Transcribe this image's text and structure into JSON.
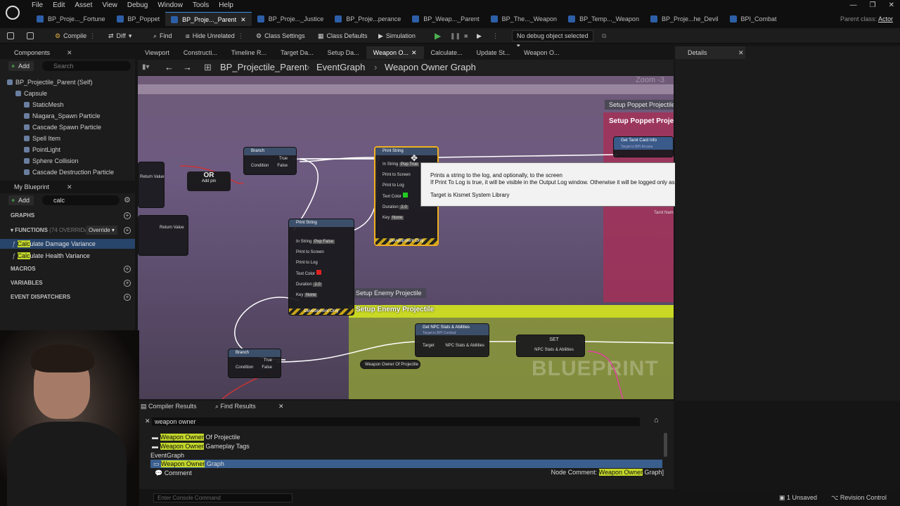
{
  "menu": [
    "File",
    "Edit",
    "Asset",
    "View",
    "Debug",
    "Window",
    "Tools",
    "Help"
  ],
  "window_controls": [
    "—",
    "❐",
    "✕"
  ],
  "tabs": [
    {
      "label": "BP_Proje..._Fortune",
      "active": false
    },
    {
      "label": "BP_Poppet",
      "active": false
    },
    {
      "label": "BP_Proje..._Parent",
      "active": true
    },
    {
      "label": "BP_Proje..._Justice",
      "active": false
    },
    {
      "label": "BP_Proje...perance",
      "active": false
    },
    {
      "label": "BP_Weap..._Parent",
      "active": false
    },
    {
      "label": "BP_The..._Weapon",
      "active": false
    },
    {
      "label": "BP_Temp..._Weapon",
      "active": false
    },
    {
      "label": "BP_Proje...he_Devil",
      "active": false
    },
    {
      "label": "BPI_Combat",
      "active": false
    }
  ],
  "parent_class": {
    "label": "Parent class:",
    "value": "Actor"
  },
  "toolbar": {
    "compile": "Compile",
    "diff": "Diff",
    "find": "Find",
    "hide_unrelated": "Hide Unrelated",
    "class_settings": "Class Settings",
    "class_defaults": "Class Defaults",
    "simulation": "Simulation",
    "debug_object": "No debug object selected"
  },
  "components": {
    "title": "Components",
    "add": "Add",
    "search_placeholder": "Search",
    "tree": [
      {
        "label": "BP_Projectile_Parent (Self)",
        "indent": 0
      },
      {
        "label": "Capsule",
        "indent": 1
      },
      {
        "label": "StaticMesh",
        "indent": 2
      },
      {
        "label": "Niagara_Spawn Particle",
        "indent": 2
      },
      {
        "label": "Cascade Spawn Particle",
        "indent": 2
      },
      {
        "label": "Spell Item",
        "indent": 2
      },
      {
        "label": "PointLight",
        "indent": 2
      },
      {
        "label": "Sphere Collision",
        "indent": 2
      },
      {
        "label": "Cascade Destruction Particle",
        "indent": 2
      }
    ]
  },
  "my_blueprint": {
    "title": "My Blueprint",
    "add": "Add",
    "search_value": "calc",
    "sections": {
      "graphs": "GRAPHS",
      "functions": "FUNCTIONS",
      "functions_count": "(74 OVERRIDABLE)",
      "override": "Override",
      "macros": "MACROS",
      "variables": "VARIABLES",
      "event_dispatchers": "EVENT DISPATCHERS"
    },
    "functions": [
      {
        "match": "Calc",
        "rest": "ulate Damage Variance",
        "selected": true
      },
      {
        "match": "Calc",
        "rest": "ulate Health Variance",
        "selected": false
      }
    ]
  },
  "graph_tabs": [
    {
      "label": "Viewport",
      "active": false
    },
    {
      "label": "Constructi...",
      "active": false
    },
    {
      "label": "Timeline R...",
      "active": false
    },
    {
      "label": "Target Da...",
      "active": false
    },
    {
      "label": "Setup Da...",
      "active": false
    },
    {
      "label": "Weapon O...",
      "active": true
    },
    {
      "label": "Calculate...",
      "active": false
    },
    {
      "label": "Update St...",
      "active": false
    },
    {
      "label": "Weapon O...",
      "active": false
    }
  ],
  "breadcrumb": [
    "BP_Projectile_Parent",
    "EventGraph",
    "Weapon Owner Graph"
  ],
  "zoom": "Zoom -3",
  "graph": {
    "comment_setup_poppet_small": "Setup Poppet Projectile",
    "comment_setup_poppet": "Setup Poppet Projecti",
    "comment_setup_enemy_small": "Setup Enemy Projectile",
    "comment_setup_enemy": "Setup Enemy Projectile",
    "watermark": "BLUEPRINT",
    "or_label": "OR",
    "or_add_pin": "Add pin",
    "return_value": "Return Value",
    "branch1": {
      "title": "Branch",
      "pins": [
        "Condition",
        "True",
        "False"
      ]
    },
    "branch2": {
      "title": "Branch",
      "pins": [
        "Condition",
        "True",
        "False"
      ]
    },
    "print1": {
      "title": "Print String",
      "in_string": "In String",
      "in_value": "Pop True",
      "pins": [
        "Print to Screen",
        "Print to Log",
        "Text Color",
        "Duration",
        "Key"
      ],
      "duration": "2.0",
      "key": "None",
      "dev": "Development Only"
    },
    "print2": {
      "title": "Print String",
      "in_string": "In String",
      "in_value": "Pop False",
      "pins": [
        "Print to Screen",
        "Print to Log",
        "Text Color",
        "Duration",
        "Key"
      ],
      "duration": "2.0",
      "key": "None",
      "dev": "Development Only"
    },
    "tarot": {
      "title": "Get Tarot Card Info",
      "subtitle": "Target is BPI Arcana"
    },
    "tarot_name": "Tarot Nam",
    "npc": {
      "title": "Get NPC Stats & Abilities",
      "subtitle": "Target is BPI Combat",
      "pins": [
        "Target",
        "NPC Stats & Abilities"
      ]
    },
    "set": {
      "title": "SET",
      "pin": "NPC Stats & Abilities"
    },
    "weapon_owner_node": "Weapon Owner Of Projectile"
  },
  "tooltip": {
    "line1": "Prints a string to the log, and optionally, to the screen",
    "line2": "If Print To Log is true, it will be visible in the Output Log window.  Otherwise it will be logged only as 'Verbose', so it generally won't show up.",
    "line3": "Target is Kismet System Library"
  },
  "details": {
    "title": "Details"
  },
  "bottom": {
    "tabs": [
      "Compiler Results",
      "Find Results"
    ],
    "search_value": "weapon owner",
    "results": [
      {
        "match": "Weapon Owner",
        "rest": " Of Projectile",
        "kind": "var",
        "selected": false
      },
      {
        "match": "Weapon Owner",
        "rest": " Gameplay Tags",
        "kind": "var",
        "selected": false
      },
      {
        "match": "",
        "rest": "EventGraph",
        "kind": "header",
        "selected": false
      },
      {
        "match": "Weapon Owner",
        "rest": " Graph",
        "kind": "graph",
        "selected": true
      },
      {
        "match": "",
        "rest": "Comment",
        "kind": "comment",
        "selected": false
      }
    ],
    "node_comment_label": "Node Comment: ",
    "node_comment_match": "Weapon Owner",
    "node_comment_rest": " Graph]"
  },
  "status": {
    "console_placeholder": "Enter Console Command",
    "unsaved": "1 Unsaved",
    "revision": "Revision Control"
  }
}
